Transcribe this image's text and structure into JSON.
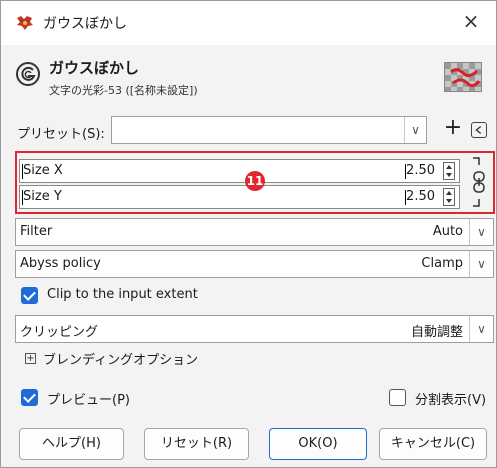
{
  "window": {
    "title": "ガウスぼかし",
    "close_glyph": "×"
  },
  "header": {
    "title": "ガウスぼかし",
    "subtitle": "文字の光彩-53 ([名称未設定])"
  },
  "preset": {
    "label": "プリセット(S):",
    "value": "",
    "dropdown_glyph": "∨",
    "add_glyph": "+"
  },
  "size": {
    "x": {
      "label": "Size X",
      "value": "2.50"
    },
    "y": {
      "label": "Size Y",
      "value": "2.50"
    },
    "marker": "11"
  },
  "filter": {
    "label": "Filter",
    "value": "Auto"
  },
  "abyss": {
    "label": "Abyss policy",
    "value": "Clamp"
  },
  "clip": {
    "label": "Clip to the input extent",
    "checked": true
  },
  "clipping": {
    "label": "クリッピング",
    "value": "自動調整"
  },
  "blending": {
    "label": "ブレンディングオプション",
    "expander_glyph": "⊞"
  },
  "preview": {
    "label": "プレビュー(P)",
    "checked": true
  },
  "split": {
    "label": "分割表示(V)",
    "checked": false
  },
  "buttons": {
    "help": "ヘルプ(H)",
    "reset": "リセット(R)",
    "ok": "OK(O)",
    "cancel": "キャンセル(C)"
  },
  "colors": {
    "accent": "#1f6cd6",
    "highlight": "#e0262e"
  }
}
